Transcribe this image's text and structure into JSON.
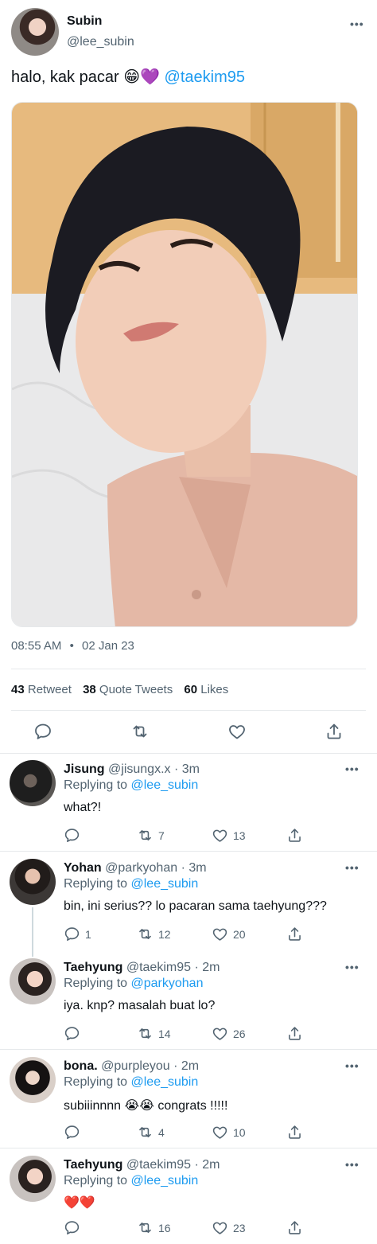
{
  "tweet": {
    "author_name": "Subin",
    "author_handle": "@lee_subin",
    "text_before": "halo, kak pacar",
    "emoji": "😁💜",
    "mention": "@taekim95",
    "timestamp": "08:55 AM",
    "date": "02 Jan 23",
    "separator": "•",
    "stats": {
      "retweets_count": "43",
      "retweets_label": "Retweet",
      "quotes_count": "38",
      "quotes_label": "Quote Tweets",
      "likes_count": "60",
      "likes_label": "Likes"
    },
    "more": "•••"
  },
  "replying_to_label": "Replying to",
  "replies": [
    {
      "name": "Jisung",
      "handle": "@jisungx.x",
      "time": "· 3m",
      "replying_to": "@lee_subin",
      "text": "what?!",
      "reply_count": "",
      "retweet_count": "7",
      "like_count": "13"
    },
    {
      "name": "Yohan",
      "handle": "@parkyohan",
      "time": "· 3m",
      "replying_to": "@lee_subin",
      "text": "bin, ini serius?? lo pacaran sama taehyung???",
      "reply_count": "1",
      "retweet_count": "12",
      "like_count": "20"
    },
    {
      "name": "Taehyung",
      "handle": "@taekim95",
      "time": "· 2m",
      "replying_to": "@parkyohan",
      "text": "iya. knp? masalah buat lo?",
      "reply_count": "",
      "retweet_count": "14",
      "like_count": "26"
    },
    {
      "name": "bona.",
      "handle": "@purpleyou",
      "time": "· 2m",
      "replying_to": "@lee_subin",
      "text_before": "subiiinnnn",
      "emoji": "😭😭",
      "text_after": "congrats !!!!!",
      "reply_count": "",
      "retweet_count": "4",
      "like_count": "10"
    },
    {
      "name": "Taehyung",
      "handle": "@taekim95",
      "time": "· 2m",
      "replying_to": "@lee_subin",
      "emoji": "❤️❤️",
      "reply_count": "",
      "retweet_count": "16",
      "like_count": "23"
    }
  ],
  "colors": {
    "link": "#1d9bf0",
    "muted": "#536471",
    "divider": "#e6e9eb",
    "text": "#0f1419"
  },
  "icons": [
    "reply-icon",
    "retweet-icon",
    "like-icon",
    "share-icon",
    "more-icon"
  ]
}
